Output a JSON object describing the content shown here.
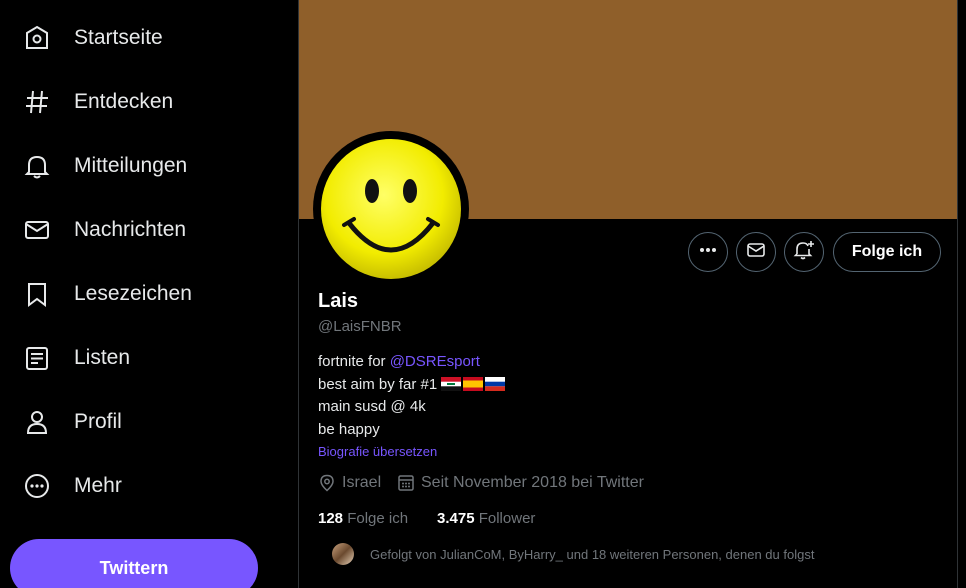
{
  "sidebar": {
    "items": [
      {
        "label": "Startseite",
        "icon": "home-icon"
      },
      {
        "label": "Entdecken",
        "icon": "hashtag-icon"
      },
      {
        "label": "Mitteilungen",
        "icon": "bell-icon"
      },
      {
        "label": "Nachrichten",
        "icon": "envelope-icon"
      },
      {
        "label": "Lesezeichen",
        "icon": "bookmark-icon"
      },
      {
        "label": "Listen",
        "icon": "list-icon"
      },
      {
        "label": "Profil",
        "icon": "person-icon"
      },
      {
        "label": "Mehr",
        "icon": "more-circle-icon"
      }
    ],
    "tweet_label": "Twittern"
  },
  "profile": {
    "banner_color": "#8f5f2a",
    "name": "Lais",
    "handle": "@LaisFNBR",
    "bio": {
      "line1_prefix": "fortnite for ",
      "line1_link": "@DSREsport",
      "line2": "best aim by far #1",
      "line2_flags": [
        "iraq-flag",
        "spain-flag",
        "russia-flag"
      ],
      "line3": "main susd @ 4k",
      "line4": "be happy"
    },
    "translate_label": "Biografie übersetzen",
    "location": "Israel",
    "joined": "Seit November 2018 bei Twitter",
    "following_count": "128",
    "following_label": "Folge ich",
    "followers_count": "3.475",
    "followers_label": "Follower",
    "followed_by": "Gefolgt von JulianCoM, ByHarry_ und 18 weiteren Personen, denen du folgst"
  },
  "actions": {
    "follow_label": "Folge ich",
    "more_icon": "more-dots-icon",
    "message_icon": "envelope-icon",
    "notify_icon": "bell-plus-icon"
  },
  "colors": {
    "accent": "#7856ff",
    "background": "#000000",
    "muted": "#71767b"
  }
}
